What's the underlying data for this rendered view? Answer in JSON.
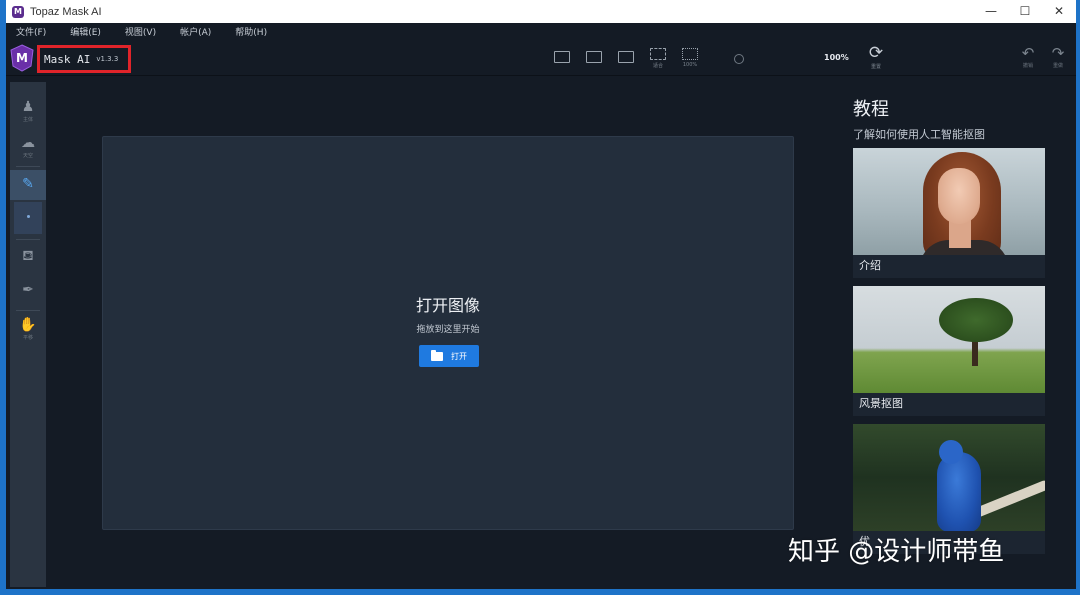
{
  "window": {
    "title": "Topaz Mask AI",
    "controls": {
      "minimize": "—",
      "maximize": "☐",
      "close": "✕"
    }
  },
  "menu": {
    "items": [
      "文件(F)",
      "编辑(E)",
      "视图(V)",
      "帐户(A)",
      "帮助(H)"
    ]
  },
  "toolbar": {
    "app_name": "Mask AI",
    "version": "v1.3.3",
    "zoom": "100%",
    "view_labels": [
      "",
      "",
      "",
      "适合",
      "100%"
    ],
    "reset_label": "重置",
    "undo_label": "撤销",
    "redo_label": "重做"
  },
  "tools": {
    "labels": [
      "主体",
      "天空",
      "",
      "",
      "",
      "",
      "平移"
    ]
  },
  "canvas": {
    "title": "打开图像",
    "subtitle": "拖放到这里开始",
    "open_label": "打开"
  },
  "tutorial": {
    "title": "教程",
    "subtitle": "了解如何使用人工智能抠图",
    "cards": [
      {
        "caption": "介绍"
      },
      {
        "caption": "风景抠图"
      },
      {
        "caption": "优"
      }
    ]
  },
  "watermark": "知乎 @设计师带鱼",
  "colors": {
    "frame": "#1e73c8",
    "highlight_box": "#e0242a",
    "primary_button": "#1f7ae0",
    "active_tool": "#59a8f0"
  }
}
